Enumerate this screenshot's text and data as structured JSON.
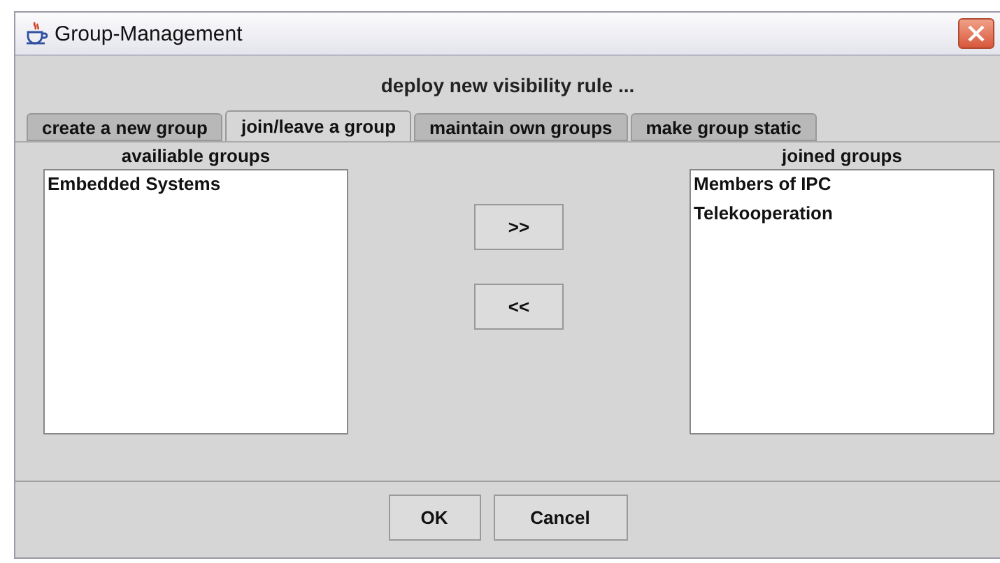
{
  "window": {
    "title": "Group-Management"
  },
  "heading": "deploy new visibility rule ...",
  "tabs": [
    {
      "label": "create a new group",
      "selected": false
    },
    {
      "label": "join/leave a group",
      "selected": true
    },
    {
      "label": "maintain own groups",
      "selected": false
    },
    {
      "label": "make group static",
      "selected": false
    }
  ],
  "available_groups": {
    "label": "availiable groups",
    "items": [
      "Embedded Systems"
    ]
  },
  "move_buttons": [
    ">>",
    "<<"
  ],
  "joined_groups": {
    "label": "joined groups",
    "items": [
      "Members of IPC",
      "Telekooperation"
    ]
  },
  "buttons": [
    "OK",
    "Cancel"
  ]
}
